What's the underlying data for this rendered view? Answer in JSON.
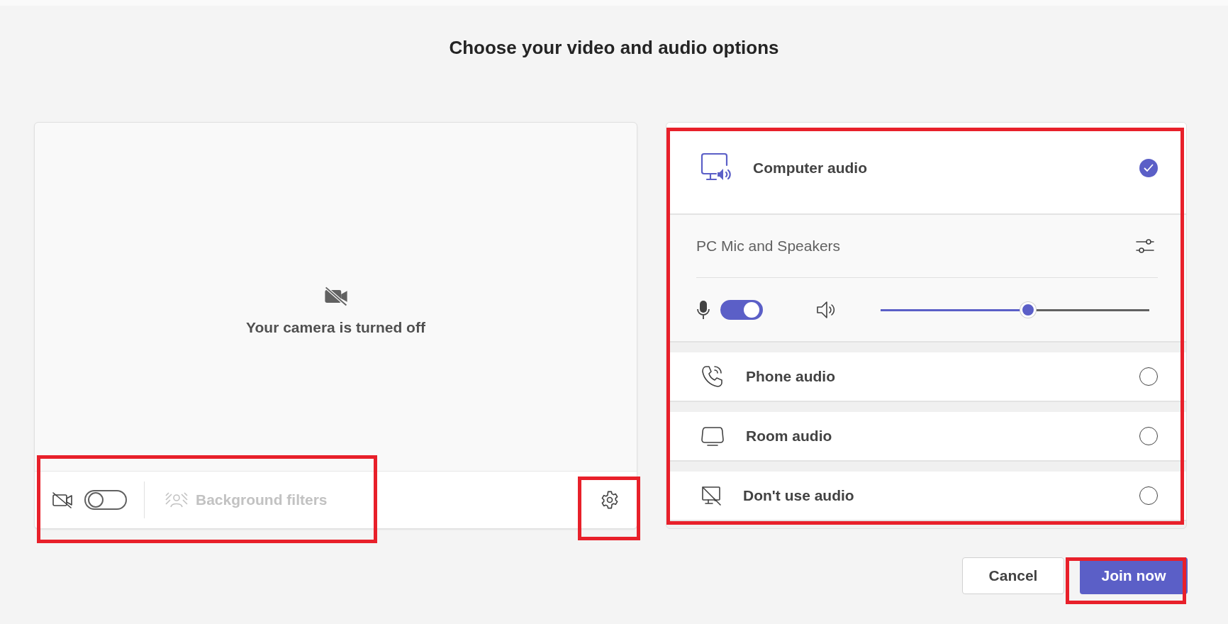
{
  "title": "Choose your video and audio options",
  "camera_preview": {
    "message": "Your camera is turned off",
    "camera_on": false,
    "background_filters": {
      "label": "Background filters",
      "disabled": true
    }
  },
  "audio_options": [
    {
      "kind": "computer",
      "label": "Computer audio",
      "selected": true,
      "device": "PC Mic and Speakers",
      "mic_on": true,
      "volume": {
        "level": 0.55
      }
    },
    {
      "kind": "phone",
      "label": "Phone audio",
      "selected": false
    },
    {
      "kind": "room",
      "label": "Room audio",
      "selected": false
    },
    {
      "kind": "none",
      "label": "Don't use audio",
      "selected": false
    }
  ],
  "buttons": [
    {
      "label": "Cancel",
      "primary": false
    },
    {
      "label": "Join now",
      "primary": true
    }
  ]
}
